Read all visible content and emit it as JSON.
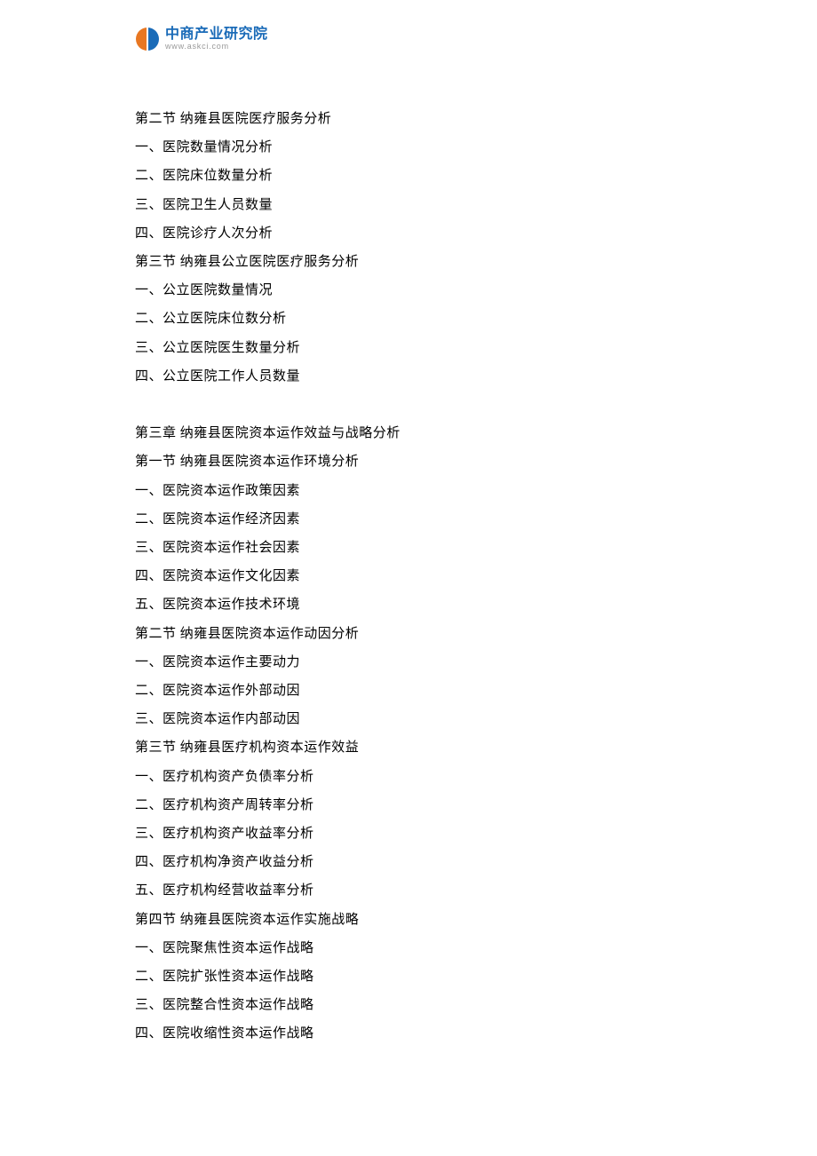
{
  "logo": {
    "title": "中商产业研究院",
    "subtitle": "www.askci.com"
  },
  "content": {
    "lines": [
      "第二节  纳雍县医院医疗服务分析",
      "一、医院数量情况分析",
      "二、医院床位数量分析",
      "三、医院卫生人员数量",
      "四、医院诊疗人次分析",
      "第三节  纳雍县公立医院医疗服务分析",
      "一、公立医院数量情况",
      "二、公立医院床位数分析",
      "三、公立医院医生数量分析",
      "四、公立医院工作人员数量",
      "",
      "第三章  纳雍县医院资本运作效益与战略分析",
      "第一节  纳雍县医院资本运作环境分析",
      "一、医院资本运作政策因素",
      "二、医院资本运作经济因素",
      "三、医院资本运作社会因素",
      "四、医院资本运作文化因素",
      "五、医院资本运作技术环境",
      "第二节  纳雍县医院资本运作动因分析",
      "一、医院资本运作主要动力",
      "二、医院资本运作外部动因",
      "三、医院资本运作内部动因",
      "第三节  纳雍县医疗机构资本运作效益",
      "一、医疗机构资产负债率分析",
      "二、医疗机构资产周转率分析",
      "三、医疗机构资产收益率分析",
      "四、医疗机构净资产收益分析",
      "五、医疗机构经营收益率分析",
      "第四节  纳雍县医院资本运作实施战略",
      "一、医院聚焦性资本运作战略",
      "二、医院扩张性资本运作战略",
      "三、医院整合性资本运作战略",
      "四、医院收缩性资本运作战略"
    ]
  }
}
